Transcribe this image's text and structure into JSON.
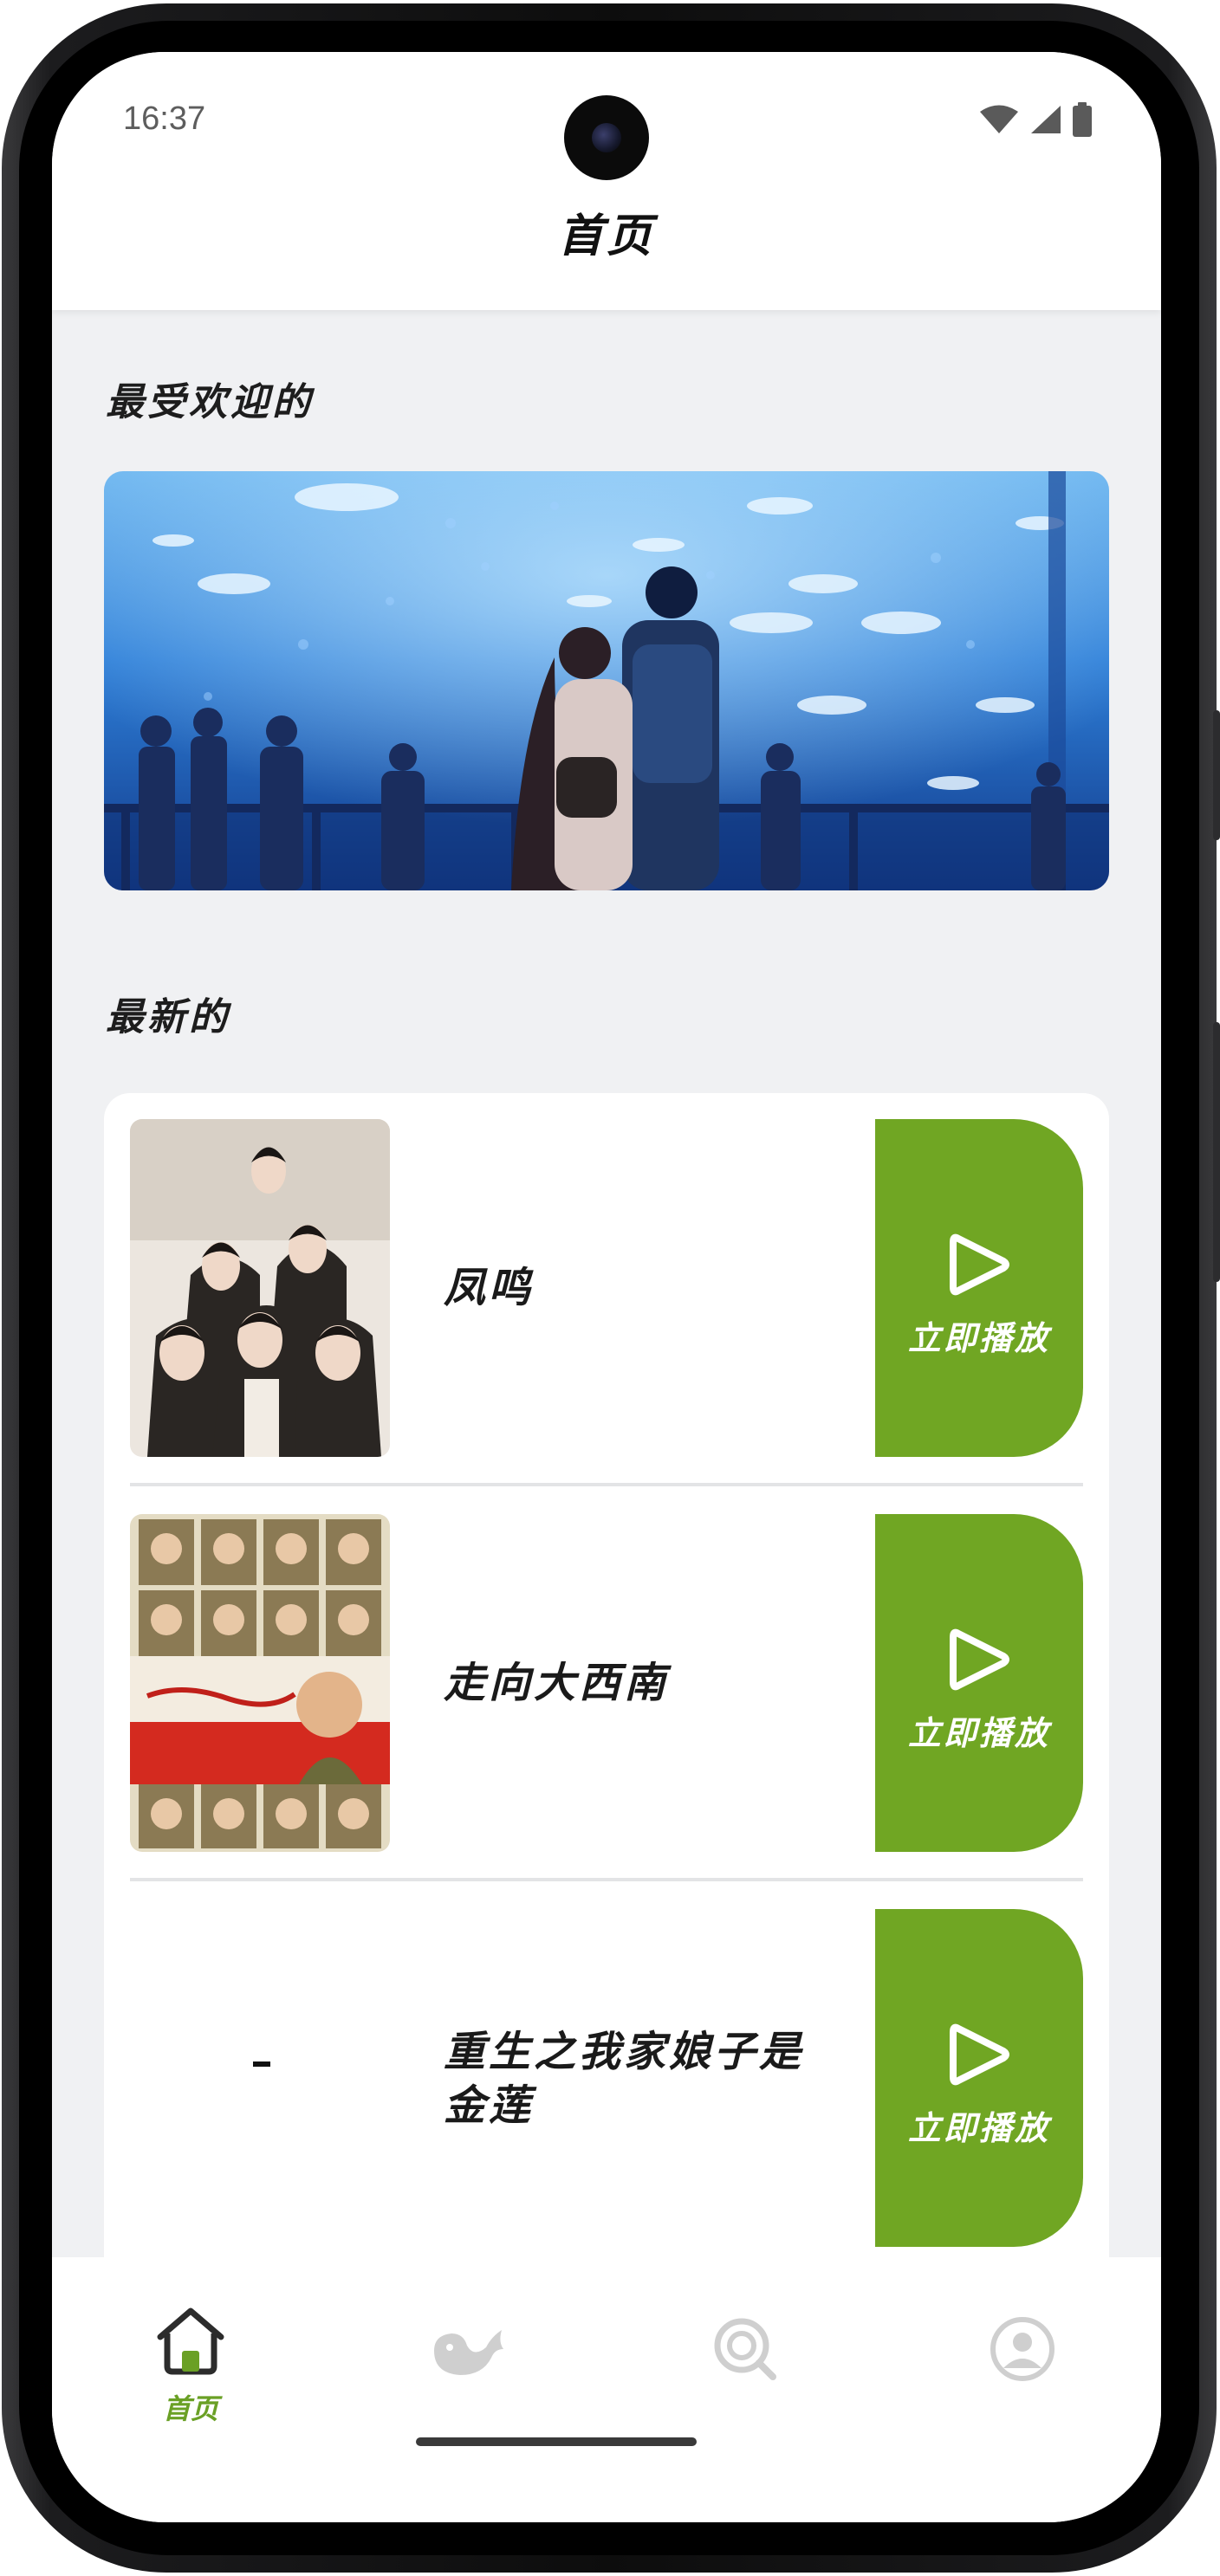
{
  "status_bar": {
    "time": "16:37",
    "icons": [
      "wifi-icon",
      "cellular-signal-icon",
      "battery-icon"
    ]
  },
  "header": {
    "title": "首页"
  },
  "popular": {
    "heading": "最受欢迎的",
    "banner_image": "aquarium-couple-illustration"
  },
  "latest": {
    "heading": "最新的",
    "items": [
      {
        "title": "凤鸣",
        "poster": "cast-group-poster",
        "play_label": "立即播放"
      },
      {
        "title": "走向大西南",
        "poster": "historical-drama-poster",
        "play_label": "立即播放"
      },
      {
        "title": "重生之我家娘子是金莲",
        "poster_placeholder": "-",
        "play_label": "立即播放"
      }
    ]
  },
  "tabbar": {
    "active_color": "#6aa025",
    "inactive_color": "#c8c8c8",
    "tabs": [
      {
        "label": "首页",
        "icon": "home-icon",
        "active": true
      },
      {
        "label": "",
        "icon": "whale-icon",
        "active": false
      },
      {
        "label": "",
        "icon": "search-icon",
        "active": false
      },
      {
        "label": "",
        "icon": "profile-icon",
        "active": false
      }
    ]
  },
  "colors": {
    "accent": "#70a623",
    "background": "#f0f1f3"
  }
}
